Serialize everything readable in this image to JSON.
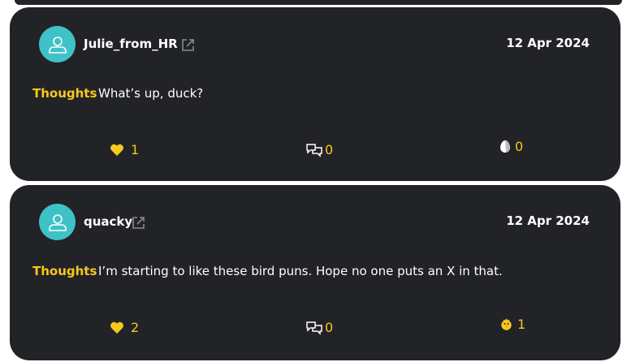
{
  "posts": [
    {
      "username": "Julie_from_HR",
      "date": "12 Apr 2024",
      "tag": "Thoughts",
      "text": "What’s up, duck?",
      "likes": "1",
      "comments": "0",
      "reaction_count": "0",
      "reaction_icon": "egg-icon"
    },
    {
      "username": "quacky",
      "date": "12 Apr 2024",
      "tag": "Thoughts",
      "text": "I’m starting to like these bird puns. Hope no one puts an X in that.",
      "likes": "2",
      "comments": "0",
      "reaction_count": "1",
      "reaction_icon": "chick-icon"
    }
  ],
  "colors": {
    "card_bg": "#222327",
    "accent": "#f7c81e",
    "avatar_bg": "#3fc2c7",
    "text": "#ffffff"
  }
}
